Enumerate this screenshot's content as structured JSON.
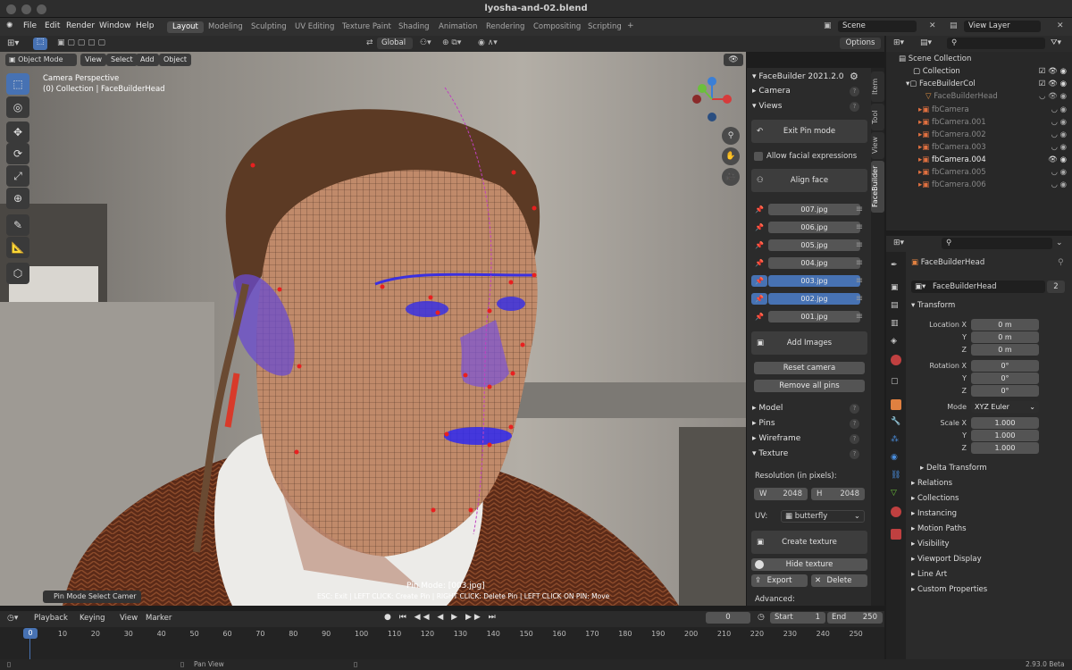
{
  "window": {
    "title": "lyosha-and-02.blend"
  },
  "menu": [
    "File",
    "Edit",
    "Render",
    "Window",
    "Help"
  ],
  "workspaces": [
    "Layout",
    "Modeling",
    "Sculpting",
    "UV Editing",
    "Texture Paint",
    "Shading",
    "Animation",
    "Rendering",
    "Compositing",
    "Scripting"
  ],
  "active_workspace": "Layout",
  "scene": "Scene",
  "view_layer": "View Layer",
  "header": {
    "transform": "Global",
    "options": "Options"
  },
  "viewport_header": {
    "mode": "Object Mode",
    "menus": [
      "View",
      "Select",
      "Add",
      "Object"
    ]
  },
  "viewport": {
    "camera_label": "Camera Perspective",
    "collection_label": "(0) Collection | FaceBuilderHead",
    "pin_mode": "Pin Mode: [003.jpg]",
    "hint": "ESC: Exit | LEFT CLICK: Create Pin | RIGHT CLICK: Delete Pin | LEFT CLICK ON PIN: Move",
    "last_op": "Pin Mode Select Camer"
  },
  "npanel": {
    "header": "FaceBuilder 2021.2.0",
    "sections_top": [
      "Camera",
      "Views"
    ],
    "exit_pin": "Exit Pin mode",
    "allow_expr": "Allow facial expressions",
    "align_face": "Align face",
    "images": [
      {
        "name": "007.jpg",
        "selected": false
      },
      {
        "name": "006.jpg",
        "selected": false
      },
      {
        "name": "005.jpg",
        "selected": false
      },
      {
        "name": "004.jpg",
        "selected": false
      },
      {
        "name": "003.jpg",
        "selected": true
      },
      {
        "name": "002.jpg",
        "selected": true
      },
      {
        "name": "001.jpg",
        "selected": false
      }
    ],
    "add_images": "Add Images",
    "reset_camera": "Reset camera",
    "remove_pins": "Remove all pins",
    "sections_bottom": [
      "Model",
      "Pins",
      "Wireframe",
      "Texture"
    ],
    "resolution_label": "Resolution (in pixels):",
    "res_w_label": "W",
    "res_w": "2048",
    "res_h_label": "H",
    "res_h": "2048",
    "uv_label": "UV:",
    "uv_value": "butterfly",
    "create_texture": "Create texture",
    "hide_texture": "Hide texture",
    "export": "Export",
    "delete": "Delete",
    "advanced": "Advanced:"
  },
  "side_tabs": [
    "Item",
    "Tool",
    "View",
    "FaceBuilder"
  ],
  "outliner": {
    "scene_collection": "Scene Collection",
    "rows": [
      "Collection",
      "FaceBuilderCol",
      "FaceBuilderHead",
      "fbCamera",
      "fbCamera.001",
      "fbCamera.002",
      "fbCamera.003",
      "fbCamera.004",
      "fbCamera.005",
      "fbCamera.006"
    ]
  },
  "properties": {
    "object": "FaceBuilderHead",
    "data_name": "FaceBuilderHead",
    "users": "2",
    "transform": "Transform",
    "location_label": "Location X",
    "location": [
      "0 m",
      "0 m",
      "0 m"
    ],
    "rotation_label": "Rotation X",
    "rotation": [
      "0°",
      "0°",
      "0°"
    ],
    "mode_label": "Mode",
    "mode": "XYZ Euler",
    "scale_label": "Scale X",
    "scale": [
      "1.000",
      "1.000",
      "1.000"
    ],
    "axis_y": "Y",
    "axis_z": "Z",
    "delta": "Delta Transform",
    "sections": [
      "Relations",
      "Collections",
      "Instancing",
      "Motion Paths",
      "Visibility",
      "Viewport Display",
      "Line Art",
      "Custom Properties"
    ]
  },
  "timeline": {
    "menus": [
      "Playback",
      "Keying",
      "View",
      "Marker"
    ],
    "current": "0",
    "start_label": "Start",
    "start": "1",
    "end_label": "End",
    "end": "250",
    "ticks": [
      "0",
      "10",
      "20",
      "30",
      "40",
      "50",
      "60",
      "70",
      "80",
      "90",
      "100",
      "110",
      "120",
      "130",
      "140",
      "150",
      "160",
      "170",
      "180",
      "190",
      "200",
      "210",
      "220",
      "230",
      "240",
      "250"
    ]
  },
  "status": {
    "pan": "Pan View",
    "version": "2.93.0 Beta"
  }
}
